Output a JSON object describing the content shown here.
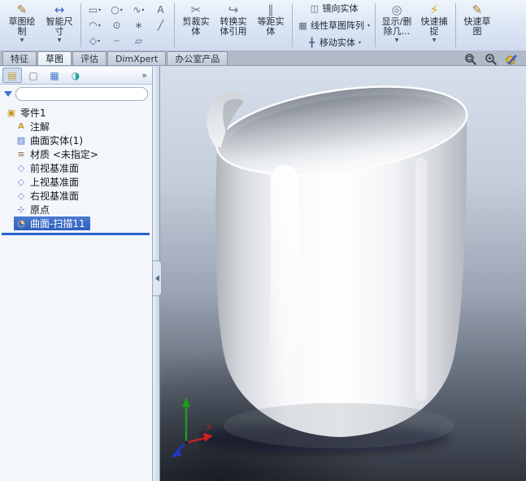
{
  "ribbon": {
    "dropdown_arrow": "▼",
    "dropdown_arrow_small": "▾",
    "buttons": {
      "sketch": {
        "label": "草图绘制",
        "glyph": "✎",
        "dropdown": true
      },
      "smart_dimension": {
        "label": "智能尺寸",
        "glyph": "↔",
        "dropdown": true
      },
      "trim": {
        "label": "剪裁实体",
        "glyph": "✂",
        "dropdown": false
      },
      "convert": {
        "label": "转换实体引用",
        "glyph": "↪",
        "dropdown": false
      },
      "offset": {
        "label": "等距实体",
        "glyph": "∥",
        "dropdown": false
      },
      "mirror": {
        "label": "镜向实体",
        "glyph": "◫"
      },
      "linear_pattern": {
        "label": "线性草图阵列",
        "glyph": "▦",
        "dropdown": true
      },
      "move": {
        "label": "移动实体",
        "glyph": "╋",
        "dropdown": true
      },
      "display_delete": {
        "label": "显示/删除几...",
        "glyph": "◎",
        "dropdown": true
      },
      "quick_snaps": {
        "label": "快速捕捉",
        "glyph": "⚡",
        "dropdown": true
      },
      "rapid_sketch": {
        "label": "快速草图",
        "glyph": "✎",
        "dropdown": false
      }
    },
    "sketch_tools": [
      {
        "name": "rectangle",
        "glyph": "▭",
        "dropdown": true
      },
      {
        "name": "circle",
        "glyph": "○",
        "dropdown": true
      },
      {
        "name": "spline",
        "glyph": "∿",
        "dropdown": true
      },
      {
        "name": "text",
        "glyph": "A",
        "dropdown": false
      },
      {
        "name": "arc",
        "glyph": "◠",
        "dropdown": true
      },
      {
        "name": "slot",
        "glyph": "⊙",
        "dropdown": false
      },
      {
        "name": "point",
        "glyph": "∗",
        "dropdown": false
      },
      {
        "name": "line",
        "glyph": "╱",
        "dropdown": false
      },
      {
        "name": "polygon",
        "glyph": "◇",
        "dropdown": true
      },
      {
        "name": "centerline",
        "glyph": "┄",
        "dropdown": false
      },
      {
        "name": "plane",
        "glyph": "▱",
        "dropdown": false
      }
    ]
  },
  "tabs": {
    "items": [
      {
        "label": "特征",
        "active": false
      },
      {
        "label": "草图",
        "active": true
      },
      {
        "label": "评估",
        "active": false
      },
      {
        "label": "DimXpert",
        "active": false
      },
      {
        "label": "办公室产品",
        "active": false
      }
    ]
  },
  "panel": {
    "tabs": [
      {
        "name": "featuremanager-tab",
        "glyph": "▤"
      },
      {
        "name": "propertymanager-tab",
        "glyph": "▢"
      },
      {
        "name": "configurationmanager-tab",
        "glyph": "▦"
      },
      {
        "name": "displaymanager-tab",
        "glyph": "◑"
      }
    ],
    "overflow_glyph": "»",
    "filter": {
      "value": "",
      "placeholder": ""
    }
  },
  "feature_tree": {
    "items": [
      {
        "label": "零件1",
        "icon": "part",
        "glyph": "▣",
        "selected": false
      },
      {
        "label": "注解",
        "icon": "annotations",
        "glyph": "A",
        "selected": false
      },
      {
        "label": "曲面实体(1)",
        "icon": "surface-bodies",
        "glyph": "▨",
        "selected": false
      },
      {
        "label": "材质 <未指定>",
        "icon": "material",
        "glyph": "≡",
        "selected": false
      },
      {
        "label": "前视基准面",
        "icon": "plane",
        "glyph": "◇",
        "selected": false
      },
      {
        "label": "上视基准面",
        "icon": "plane",
        "glyph": "◇",
        "selected": false
      },
      {
        "label": "右视基准面",
        "icon": "plane",
        "glyph": "◇",
        "selected": false
      },
      {
        "label": "原点",
        "icon": "origin",
        "glyph": "⊹",
        "selected": false
      },
      {
        "label": "曲面-扫描11",
        "icon": "surface-sweep",
        "glyph": "◔",
        "selected": true
      }
    ]
  },
  "viewport": {
    "hud_icons": [
      "zoom-fit",
      "zoom-area",
      "appearance"
    ],
    "triad": {
      "x_label": "X"
    }
  },
  "theme": {
    "selection_bg": "#2f5fbe",
    "rollback_color": "#2b63c9",
    "viewport_gradient_top": "#d6dfeb",
    "viewport_gradient_bottom": "#2f343e",
    "axis_x_color": "#cc2020",
    "axis_y_color": "#17a017",
    "axis_z_color": "#2038c8"
  }
}
